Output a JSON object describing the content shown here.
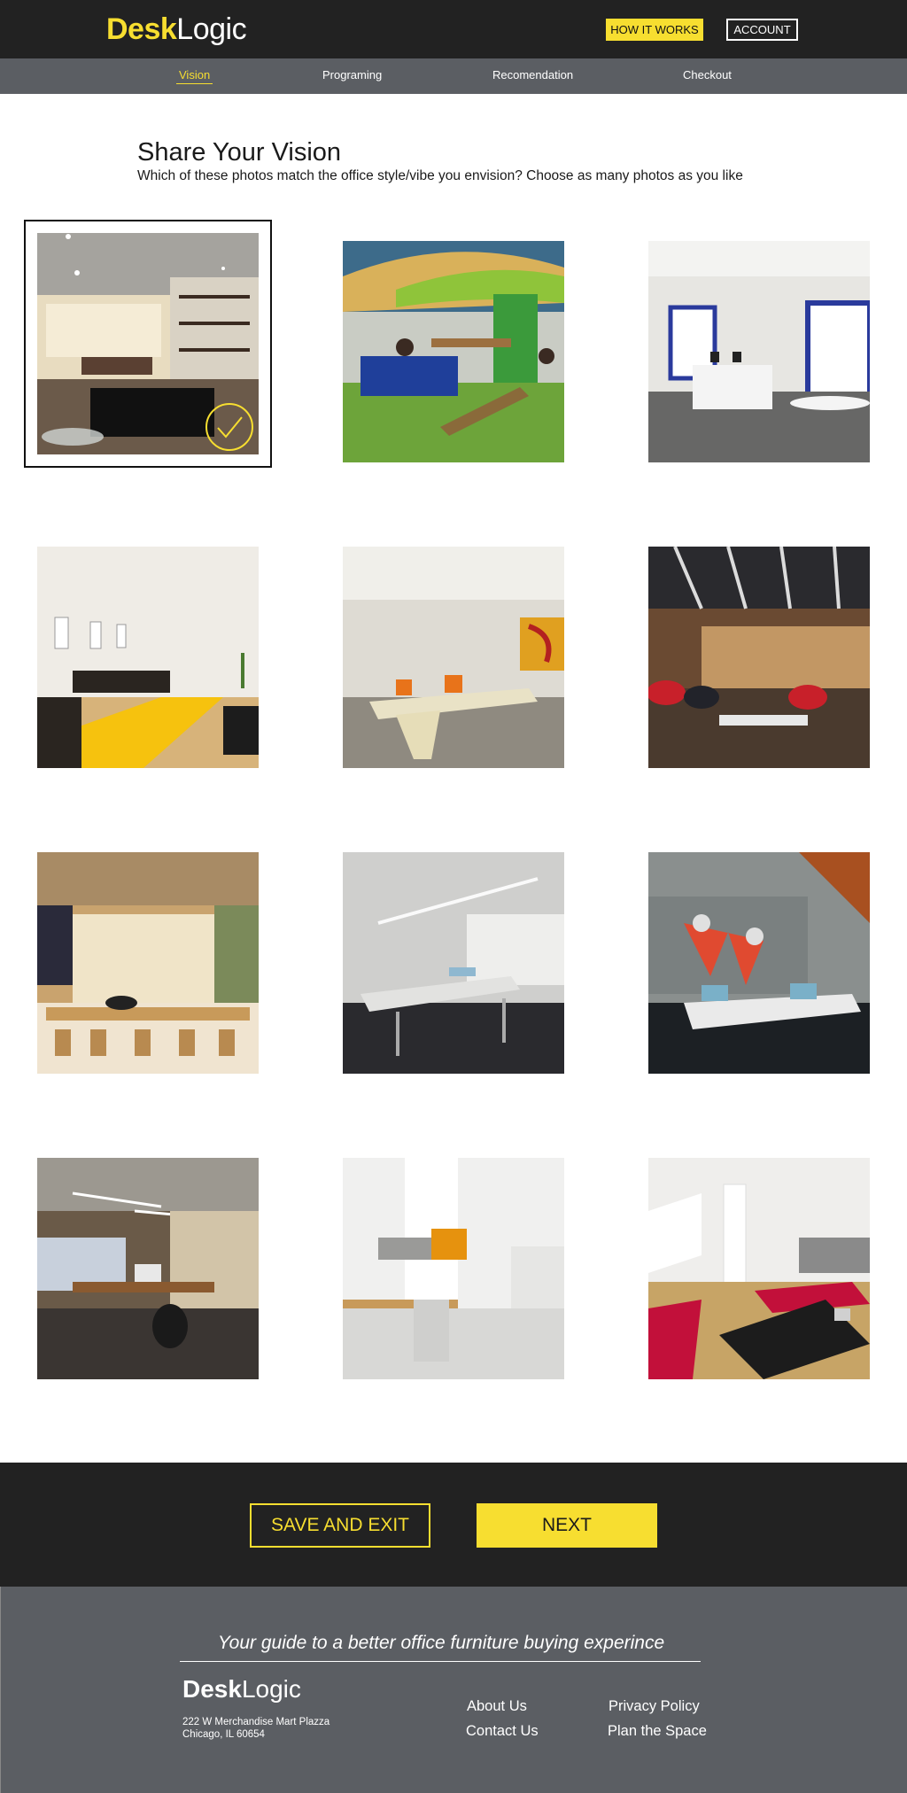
{
  "header": {
    "logo_bold": "Desk",
    "logo_light": "Logic",
    "how_it_works": "HOW IT WORKS",
    "account": "ACCOUNT"
  },
  "nav": {
    "items": [
      {
        "label": "Vision",
        "active": true
      },
      {
        "label": "Programing",
        "active": false
      },
      {
        "label": "Recomendation",
        "active": false
      },
      {
        "label": "Checkout",
        "active": false
      }
    ]
  },
  "main": {
    "title": "Share Your Vision",
    "subtitle": "Which of these photos match the office style/vibe you envision? Choose as many photos as you like"
  },
  "photos": [
    {
      "selected": true
    },
    {
      "selected": false
    },
    {
      "selected": false
    },
    {
      "selected": false
    },
    {
      "selected": false
    },
    {
      "selected": false
    },
    {
      "selected": false
    },
    {
      "selected": false
    },
    {
      "selected": false
    },
    {
      "selected": false
    },
    {
      "selected": false
    },
    {
      "selected": false
    }
  ],
  "actions": {
    "save_exit": "SAVE AND EXIT",
    "next": "NEXT"
  },
  "footer": {
    "tagline": "Your guide to a better office furniture buying experince",
    "logo_bold": "Desk",
    "logo_light": "Logic",
    "address_line1": "222 W Merchandise Mart Plazza",
    "address_line2": "Chicago, IL 60654",
    "links": {
      "about": "About Us",
      "contact": "Contact Us",
      "privacy": "Privacy Policy",
      "plan": "Plan the Space"
    }
  },
  "colors": {
    "accent": "#f7de30",
    "dark": "#222222",
    "gray": "#5b5e63"
  }
}
